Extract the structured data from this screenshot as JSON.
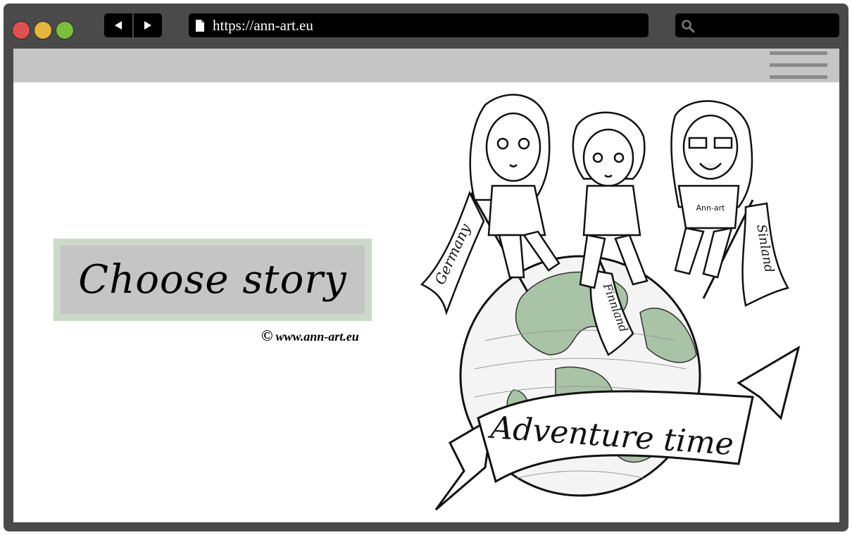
{
  "browser": {
    "url": "https://ann-art.eu",
    "traffic_lights": {
      "close": "#e05050",
      "minimize": "#e6b53c",
      "maximize": "#7cc03a"
    }
  },
  "site": {
    "choose_story_label": "Choose story",
    "copyright_symbol": "©",
    "copyright_text": "www.ann-art.eu",
    "illustration": {
      "banners": [
        "Germany",
        "Finnland",
        "Sinland"
      ],
      "ribbon": "Adventure time",
      "shirt_text": "Ann-art"
    },
    "colors": {
      "header_bg": "#c6c5c6",
      "button_border": "#cbd9c9",
      "button_bg": "#c6c5c6",
      "globe_land": "#8fae8f"
    }
  }
}
